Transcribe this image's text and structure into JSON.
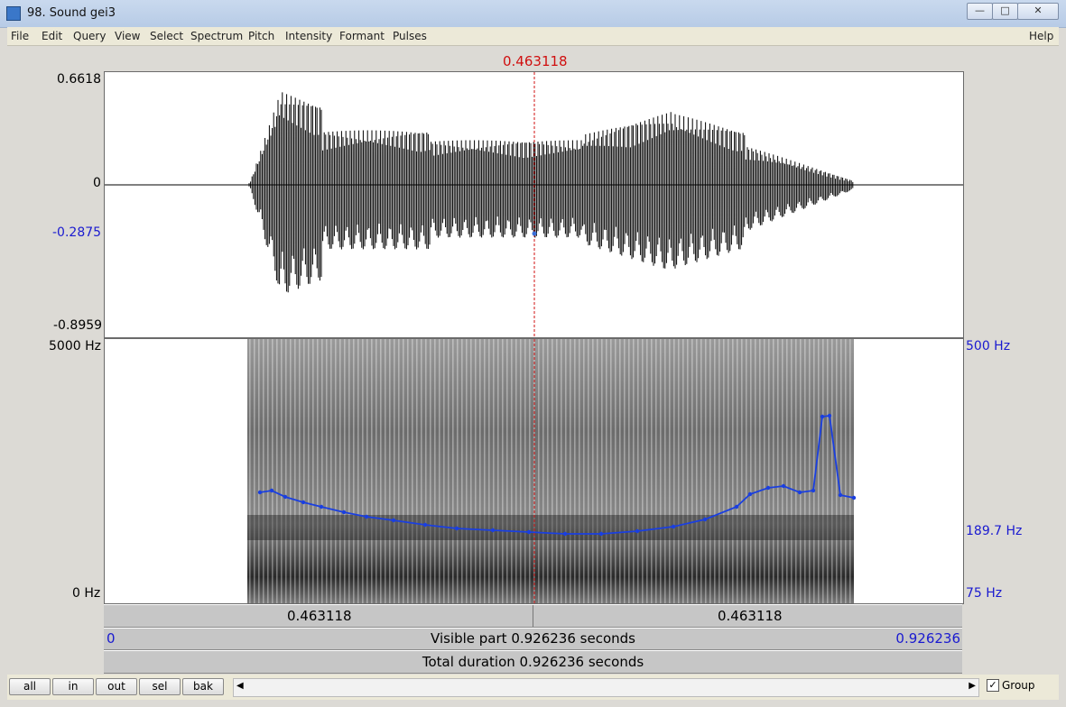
{
  "window": {
    "title": "98. Sound gei3"
  },
  "menu": [
    "File",
    "Edit",
    "Query",
    "View",
    "Select",
    "Spectrum",
    "Pitch",
    "Intensity",
    "Formant",
    "Pulses"
  ],
  "help": "Help",
  "cursor": {
    "time_label": "0.463118"
  },
  "waveform": {
    "y_max": "0.6618",
    "y_zero": "0",
    "y_cursor": "-0.2875",
    "y_min": "-0.8959"
  },
  "spectrogram": {
    "freq_top": "5000 Hz",
    "freq_bottom": "0 Hz",
    "pitch_top": "500 Hz",
    "pitch_value": "189.7 Hz",
    "pitch_bottom": "75 Hz"
  },
  "bars": {
    "left_segment": "0.463118",
    "right_segment": "0.463118",
    "visible_start": "0",
    "visible_text": "Visible part 0.926236 seconds",
    "visible_end": "0.926236",
    "total_text": "Total duration 0.926236 seconds"
  },
  "buttons": {
    "all": "all",
    "in": "in",
    "out": "out",
    "sel": "sel",
    "bak": "bak"
  },
  "group_label": "Group",
  "colors": {
    "cursor": "#d01010",
    "pitch": "#1a3fe0",
    "blue_text": "#1a1ad0"
  }
}
